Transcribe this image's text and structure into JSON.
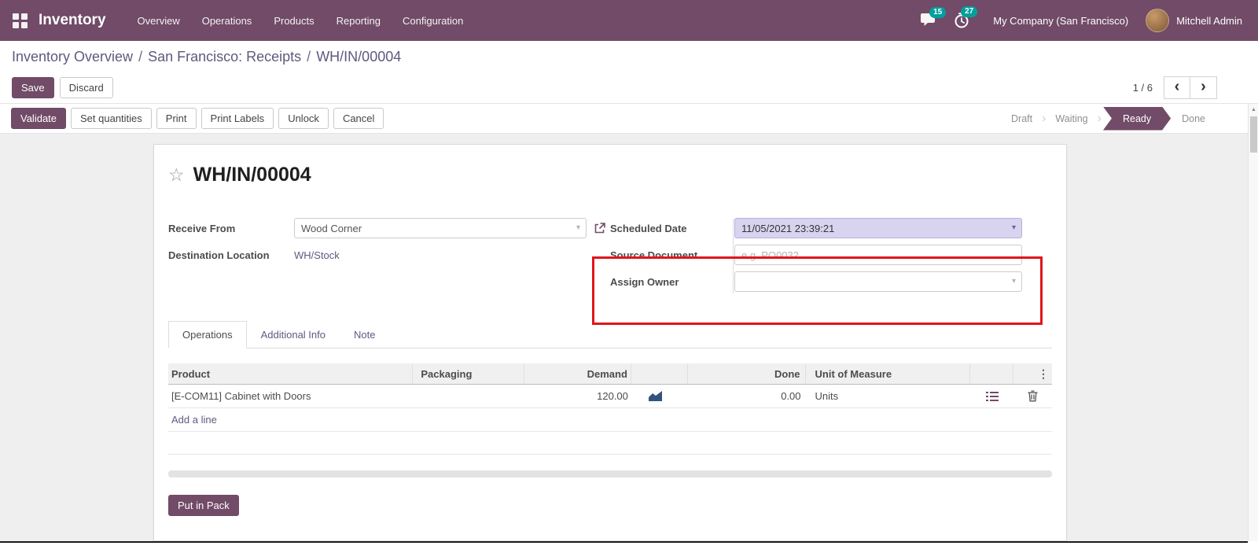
{
  "navbar": {
    "app_name": "Inventory",
    "menu_items": [
      "Overview",
      "Operations",
      "Products",
      "Reporting",
      "Configuration"
    ],
    "messages_count": "15",
    "activities_count": "27",
    "company": "My Company (San Francisco)",
    "user": "Mitchell Admin"
  },
  "breadcrumb": {
    "separator": "/",
    "items": [
      "Inventory Overview",
      "San Francisco: Receipts",
      "WH/IN/00004"
    ]
  },
  "control_panel": {
    "save_label": "Save",
    "discard_label": "Discard",
    "pager_count": "1 / 6"
  },
  "statusbar": {
    "buttons": [
      "Validate",
      "Set quantities",
      "Print",
      "Print Labels",
      "Unlock",
      "Cancel"
    ],
    "states": [
      {
        "label": "Draft"
      },
      {
        "label": "Waiting"
      },
      {
        "label": "Ready"
      },
      {
        "label": "Done"
      }
    ]
  },
  "form": {
    "title": "WH/IN/00004",
    "fields": {
      "receive_from": {
        "label": "Receive From",
        "value": "Wood Corner"
      },
      "destination_location": {
        "label": "Destination Location",
        "value": "WH/Stock"
      },
      "scheduled_date": {
        "label": "Scheduled Date",
        "value": "11/05/2021 23:39:21"
      },
      "source_document": {
        "label": "Source Document",
        "placeholder": "e.g. PO0032"
      },
      "assign_owner": {
        "label": "Assign Owner",
        "value": ""
      }
    },
    "tabs": [
      {
        "label": "Operations"
      },
      {
        "label": "Additional Info"
      },
      {
        "label": "Note"
      }
    ],
    "table": {
      "headers": [
        "Product",
        "Packaging",
        "Demand",
        "Done",
        "Unit of Measure"
      ],
      "rows": [
        {
          "product": "[E-COM11] Cabinet with Doors",
          "packaging": "",
          "demand": "120.00",
          "done": "0.00",
          "uom": "Units"
        }
      ],
      "add_line_label": "Add a line"
    },
    "put_in_pack_label": "Put in Pack"
  },
  "icons": {
    "star": "☆",
    "caret": "▾",
    "pager_prev": "‹",
    "pager_next": "›",
    "kebab": "⋮",
    "state_separator": "›",
    "scroll_up_arrow": "▲"
  },
  "colors": {
    "navbar_bg": "#714B67",
    "primary": "#714B67",
    "badge": "#00A09D",
    "breadcrumb_link": "#5D5A7E",
    "highlighted_field_bg": "#D8D4F0",
    "annotation_red": "#E0161A"
  }
}
